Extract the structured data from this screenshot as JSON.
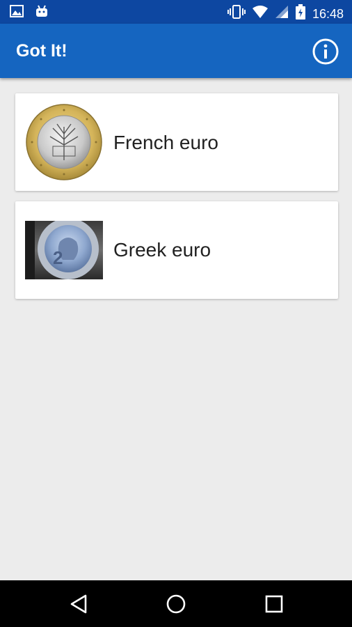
{
  "status_bar": {
    "time": "16:48",
    "left_icons": [
      "image-icon",
      "android-icon"
    ],
    "right_icons": [
      "vibrate-icon",
      "wifi-icon",
      "signal-icon",
      "battery-icon"
    ]
  },
  "app_bar": {
    "title": "Got It!",
    "action_icon": "info-icon",
    "color": "#1565C0",
    "status_color": "#0D47A1"
  },
  "coins": [
    {
      "label": "French euro",
      "thumb_icon": "french-euro-coin-image"
    },
    {
      "label": "Greek euro",
      "thumb_icon": "greek-euro-coin-image"
    }
  ],
  "nav_bar": {
    "icons": [
      "back-icon",
      "home-icon",
      "recents-icon"
    ]
  }
}
